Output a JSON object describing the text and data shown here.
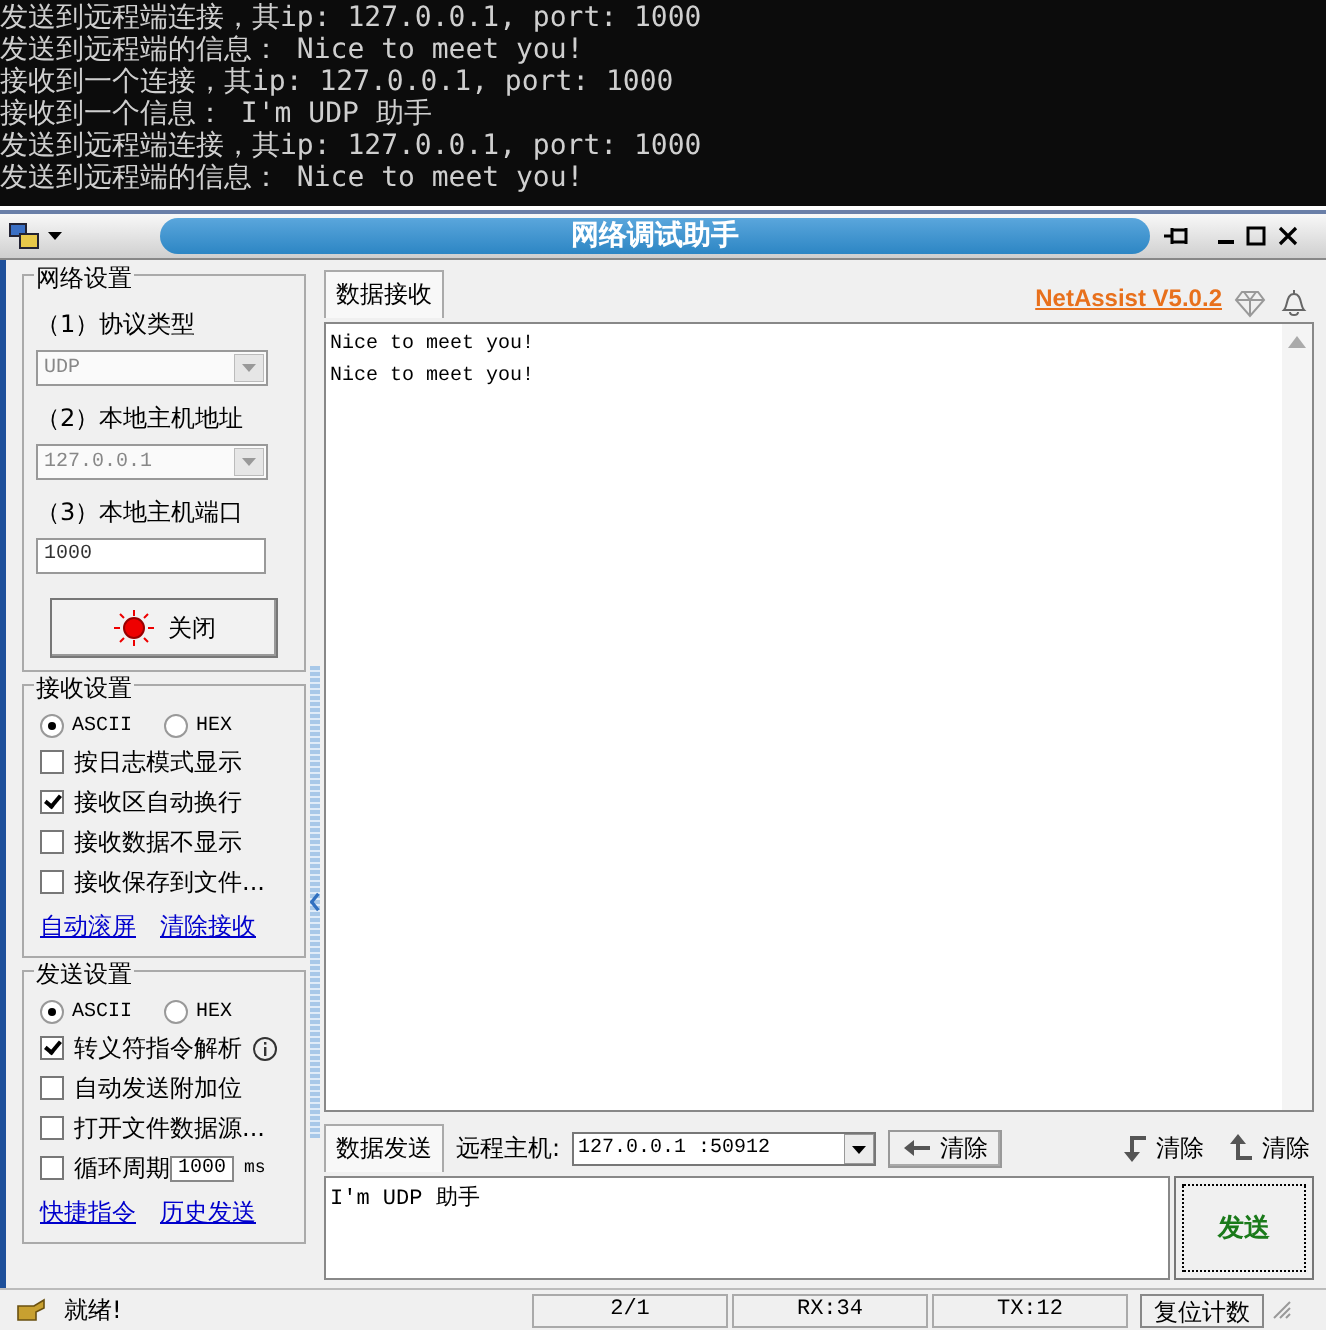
{
  "console": {
    "lines": [
      "发送到远程端连接，其ip: 127.0.0.1, port: 1000",
      "发送到远程端的信息： Nice to meet you!",
      "接收到一个连接，其ip: 127.0.0.1, port: 1000",
      "接收到一个信息： I'm UDP 助手",
      "发送到远程端连接，其ip: 127.0.0.1, port: 1000",
      "发送到远程端的信息： Nice to meet you!"
    ]
  },
  "window": {
    "title": "网络调试助手"
  },
  "network_settings": {
    "title": "网络设置",
    "fields": [
      {
        "label": "（1）协议类型",
        "kind": "select",
        "value": "UDP"
      },
      {
        "label": "（2）本地主机地址",
        "kind": "select",
        "value": "127.0.0.1"
      },
      {
        "label": "（3）本地主机端口",
        "kind": "input",
        "value": "1000"
      }
    ],
    "button": "关闭"
  },
  "receive_settings": {
    "title": "接收设置",
    "encoding": [
      {
        "label": "ASCII",
        "selected": true
      },
      {
        "label": "HEX",
        "selected": false
      }
    ],
    "options": [
      {
        "label": "按日志模式显示",
        "checked": false,
        "info": false
      },
      {
        "label": "接收区自动换行",
        "checked": true,
        "info": false
      },
      {
        "label": "接收数据不显示",
        "checked": false,
        "info": false
      },
      {
        "label": "接收保存到文件...",
        "checked": false,
        "info": false
      }
    ],
    "links": [
      "自动滚屏",
      "清除接收"
    ]
  },
  "send_settings": {
    "title": "发送设置",
    "encoding": [
      {
        "label": "ASCII",
        "selected": true
      },
      {
        "label": "HEX",
        "selected": false
      }
    ],
    "options": [
      {
        "label": "转义符指令解析",
        "checked": true,
        "info": true
      },
      {
        "label": "自动发送附加位",
        "checked": false,
        "info": false
      },
      {
        "label": "打开文件数据源...",
        "checked": false,
        "info": false
      },
      {
        "label": "循环周期",
        "checked": false,
        "info": false,
        "value": "1000",
        "unit": "ms"
      }
    ],
    "links": [
      "快捷指令",
      "历史发送"
    ]
  },
  "receive": {
    "tab": "数据接收",
    "brand": "NetAssist V5.0.2",
    "lines": [
      "Nice to meet you!",
      "Nice to meet you!"
    ]
  },
  "send": {
    "tab": "数据发送",
    "remote_label": "远程主机:",
    "remote_value": "127.0.0.1 :50912",
    "clear_buttons": [
      {
        "kind": "left",
        "label": "清除"
      },
      {
        "kind": "down",
        "label": "清除"
      },
      {
        "kind": "up",
        "label": "清除"
      }
    ],
    "text": "I'm UDP 助手",
    "button": "发送"
  },
  "status_bar": {
    "status": "就绪!",
    "counters": [
      "2/1",
      "RX:34",
      "TX:12"
    ],
    "reset": "复位计数"
  }
}
